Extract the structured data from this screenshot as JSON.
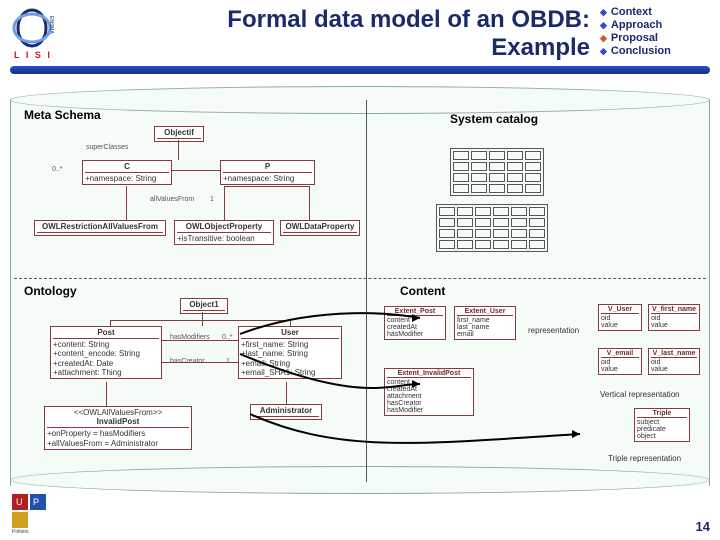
{
  "header": {
    "title_l1": "Formal data model of an OBDB:",
    "title_l2": "Example",
    "logo_top": "ENSMA",
    "logo_bot": "L I S I"
  },
  "nav": {
    "items": [
      {
        "label": "Context",
        "active": false
      },
      {
        "label": "Approach",
        "active": false
      },
      {
        "label": "Proposal",
        "active": true
      },
      {
        "label": "Conclusion",
        "active": false
      }
    ]
  },
  "quadrants": {
    "meta": "Meta Schema",
    "syscat": "System catalog",
    "onto": "Ontology",
    "content": "Content"
  },
  "meta": {
    "objectif": "Objectif",
    "superClasses": "superClasses",
    "c_name": "C",
    "c_attr": "+namespace: String",
    "p_name": "P",
    "p_attr": "+namespace: String",
    "mult": "0..*",
    "allValuesFrom": "allValuesFrom",
    "one": "1",
    "r1": "OWLRestrictionAllValuesFrom",
    "r2": "OWLObjectProperty",
    "r2_attr": "+isTransitive: boolean",
    "r3": "OWLDataProperty"
  },
  "onto": {
    "object1": "Object1",
    "post": {
      "name": "Post",
      "a1": "+content: String",
      "a2": "+content_encode: String",
      "a3": "+createdAt: Date",
      "a4": "+attachment: Thing"
    },
    "user": {
      "name": "User",
      "a1": "+first_name: String",
      "a2": "+last_name: String",
      "a3": "+email: String",
      "a4": "+email_SHA1: String"
    },
    "rel_hasModifiers": "hasModifiers",
    "rel_mult1": "0..*",
    "rel_hasCreator": "hasCreator",
    "rel_mult2": "1",
    "admin": "Administrator",
    "invalid": {
      "stereo": "<<OWLAllValuesFrom>>",
      "name": "InvalidPost",
      "a1": "+onProperty = hasModifiers",
      "a2": "+allValuesFrom = Administrator"
    }
  },
  "content": {
    "ext_post": {
      "hd": "Extent_Post",
      "r1": "content",
      "r2": "createdAt",
      "r3": "hasModifier"
    },
    "ext_user": {
      "hd": "Extent_User",
      "r1": "first_name",
      "r2": "last_name",
      "r3": "email"
    },
    "ext_inv": {
      "hd": "Extent_InvalidPost",
      "r1": "content",
      "r2": "createdAt",
      "r3": "attachment",
      "r4": "hasCreator",
      "r5": "hasModifier"
    },
    "v_user": {
      "hd": "V_User",
      "r1": "oid",
      "r2": "value"
    },
    "v_fn": {
      "hd": "V_first_name",
      "r1": "oid",
      "r2": "value"
    },
    "v_email": {
      "hd": "V_email",
      "r1": "oid",
      "r2": "value"
    },
    "v_ln": {
      "hd": "V_last_name",
      "r1": "oid",
      "r2": "value"
    },
    "triple": {
      "hd": "Triple",
      "r1": "subject",
      "r2": "predicate",
      "r3": "object"
    },
    "lab_rep": "representation",
    "lab_vert": "Vertical representation",
    "lab_tri": "Triple representation"
  },
  "page": "14"
}
